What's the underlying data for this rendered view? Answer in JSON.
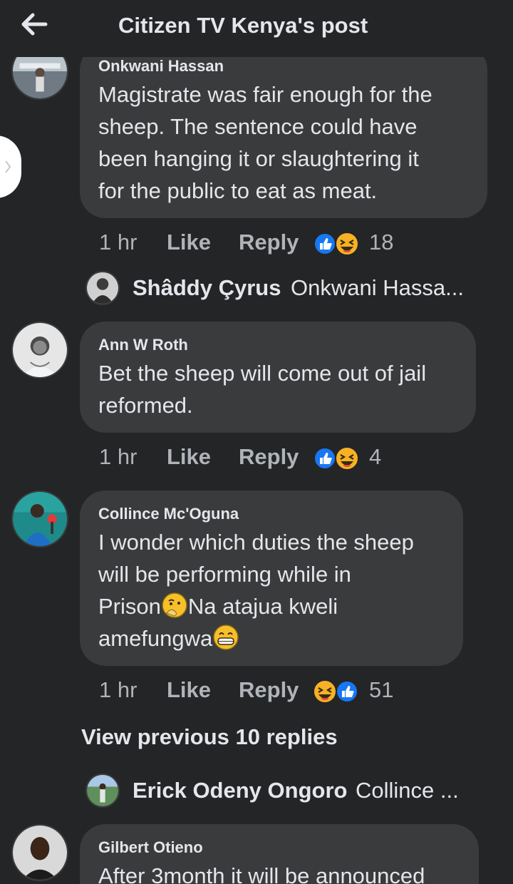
{
  "header": {
    "title": "Citizen TV Kenya's post"
  },
  "comments": [
    {
      "author": "Onkwani Hassan",
      "lines": [
        "Magistrate was fair enough for the",
        "sheep. The sentence could have",
        "been hanging it or slaughtering it",
        "for the public to eat as meat."
      ],
      "time": "1 hr",
      "like": "Like",
      "reply": "Reply",
      "reactions": "18",
      "reply_preview": {
        "name": "Shâddy Çyrus",
        "snippet": "Onkwani Hassa..."
      }
    },
    {
      "author": "Ann W Roth",
      "lines": [
        "Bet the sheep will come out of jail",
        "reformed."
      ],
      "time": "1 hr",
      "like": "Like",
      "reply": "Reply",
      "reactions": "4"
    },
    {
      "author": "Collince Mc'Oguna",
      "line1": "I wonder which duties the sheep",
      "line2": "will be performing while in",
      "line3a": "Prison",
      "line3b": "Na atajua kweli",
      "line4": "amefungwa",
      "time": "1 hr",
      "like": "Like",
      "reply": "Reply",
      "reactions": "51",
      "view_previous": "View previous 10 replies",
      "reply_preview": {
        "name": "Erick Odeny Ongoro",
        "snippet": "Collince ..."
      }
    },
    {
      "author": "Gilbert Otieno",
      "lines": [
        "After 3month it will be announced"
      ]
    }
  ],
  "colors": {
    "background": "#242526",
    "bubble": "#3a3b3c",
    "like_blue": "#1877f2",
    "haha_yellow": "#f7b125"
  }
}
